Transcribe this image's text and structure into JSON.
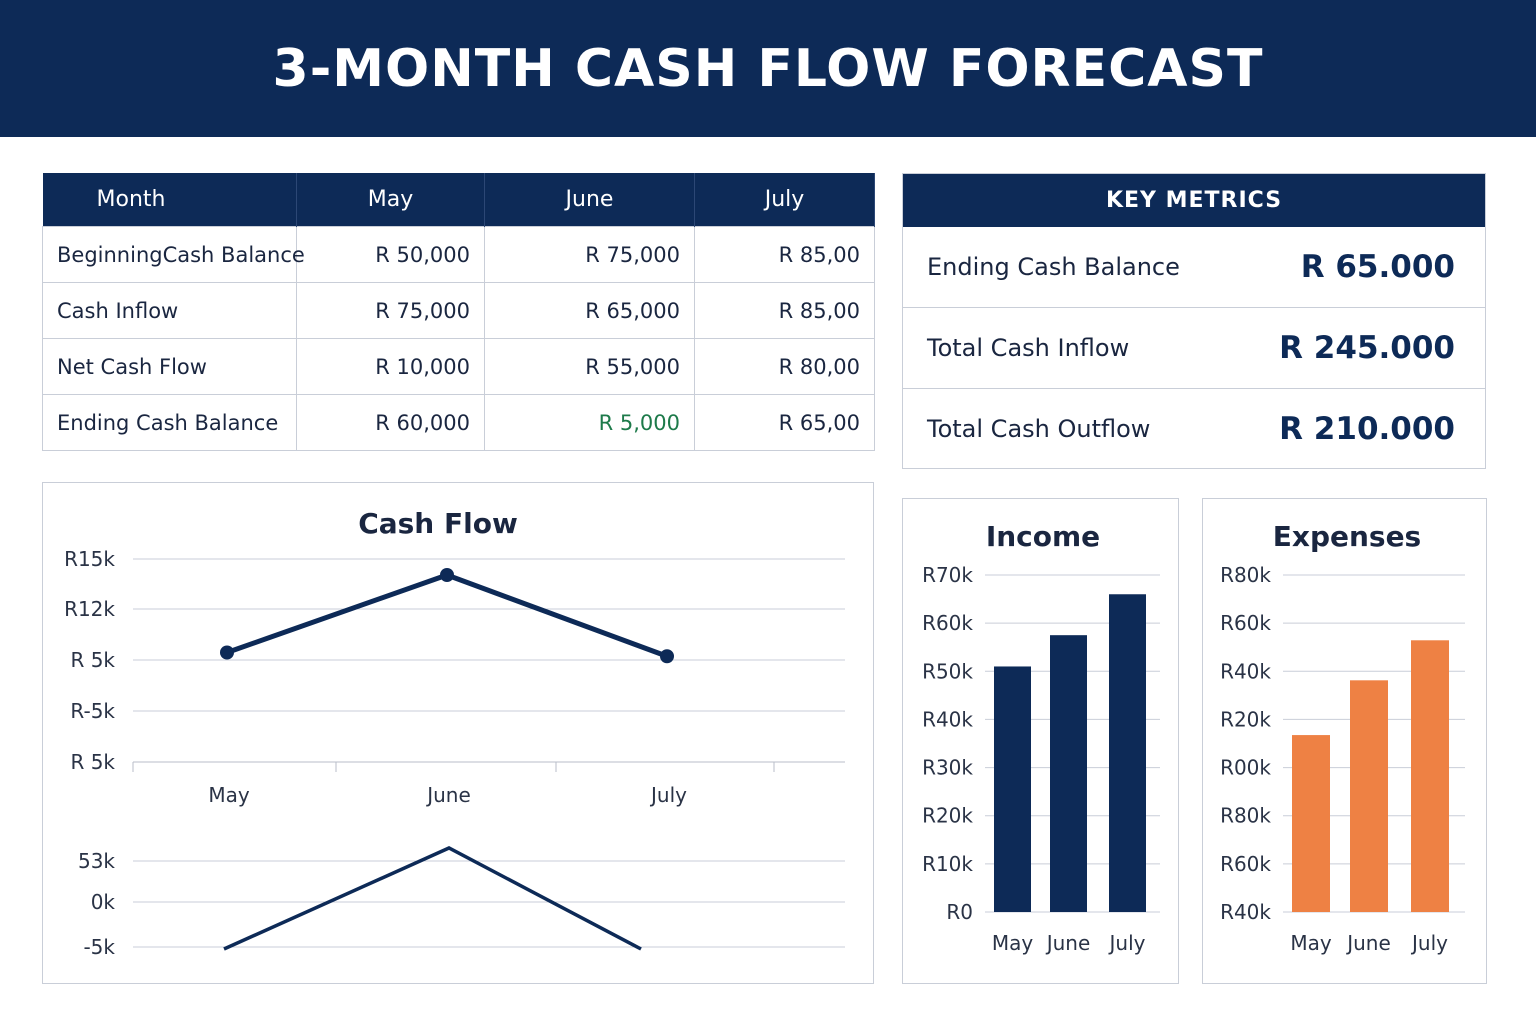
{
  "page_title": "3-MONTH CASH FLOW FORECAST",
  "colors": {
    "navy": "#0d2a57",
    "orange": "#ee8144",
    "green": "#1d7a4a"
  },
  "table": {
    "headers": [
      "Month",
      "May",
      "June",
      "July"
    ],
    "rows": [
      {
        "label": "BeginningCash Balance",
        "values": [
          "R 50,000",
          "R 75,000",
          "R 85,00"
        ]
      },
      {
        "label": "Cash Inflow",
        "values": [
          "R 75,000",
          "R 65,000",
          "R 85,00"
        ]
      },
      {
        "label": "Net Cash Flow",
        "values": [
          "R 10,000",
          "R 55,000",
          "R 80,00"
        ]
      },
      {
        "label": "Ending Cash Balance",
        "values": [
          "R 60,000",
          "R 5,000",
          "R 65,00"
        ]
      }
    ]
  },
  "key_metrics": {
    "title": "KEY METRICS",
    "rows": [
      {
        "label": "Ending Cash Balance",
        "value": "R 65.000"
      },
      {
        "label": "Total Cash Inflow",
        "value": "R 245.000"
      },
      {
        "label": "Total Cash Outflow",
        "value": "R 210.000"
      }
    ]
  },
  "chart_data": [
    {
      "type": "line",
      "title": "Cash Flow",
      "categories": [
        "May",
        "June",
        "July"
      ],
      "y_tick_labels": [
        "R15k",
        "R12k",
        "R 5k",
        "R-5k",
        "R 5k"
      ],
      "series": [
        {
          "values": [
            0.3,
            3.4,
            0.15
          ]
        }
      ],
      "ylim": [
        -2,
        4
      ],
      "grid": true,
      "markers": true,
      "color": "#0d2a57"
    },
    {
      "type": "line",
      "title": "",
      "categories": [
        "May",
        "June",
        "July"
      ],
      "y_tick_labels": [
        "53k",
        "0k",
        "-5k"
      ],
      "series": [
        {
          "values": [
            -5,
            53,
            -5
          ]
        }
      ],
      "ylim": [
        -5,
        53
      ],
      "grid": true,
      "markers": false,
      "color": "#0d2a57"
    },
    {
      "type": "bar",
      "title": "Income",
      "categories": [
        "May",
        "June",
        "July"
      ],
      "values": [
        51,
        57.5,
        66
      ],
      "ylim": [
        0,
        70
      ],
      "y_tick_labels": [
        "R70k",
        "R60k",
        "R50k",
        "R40k",
        "R30k",
        "R20k",
        "R10k",
        "R0"
      ],
      "grid": true,
      "color": "#0d2a57"
    },
    {
      "type": "bar",
      "title": "Expenses",
      "categories": [
        "May",
        "June",
        "July"
      ],
      "values": [
        42,
        55,
        64.5
      ],
      "ylim": [
        0,
        80
      ],
      "y_tick_labels": [
        "R80k",
        "R60k",
        "R40k",
        "R20k",
        "R00k",
        "R80k",
        "R60k",
        "R40k"
      ],
      "grid": true,
      "color": "#ee8144"
    }
  ]
}
